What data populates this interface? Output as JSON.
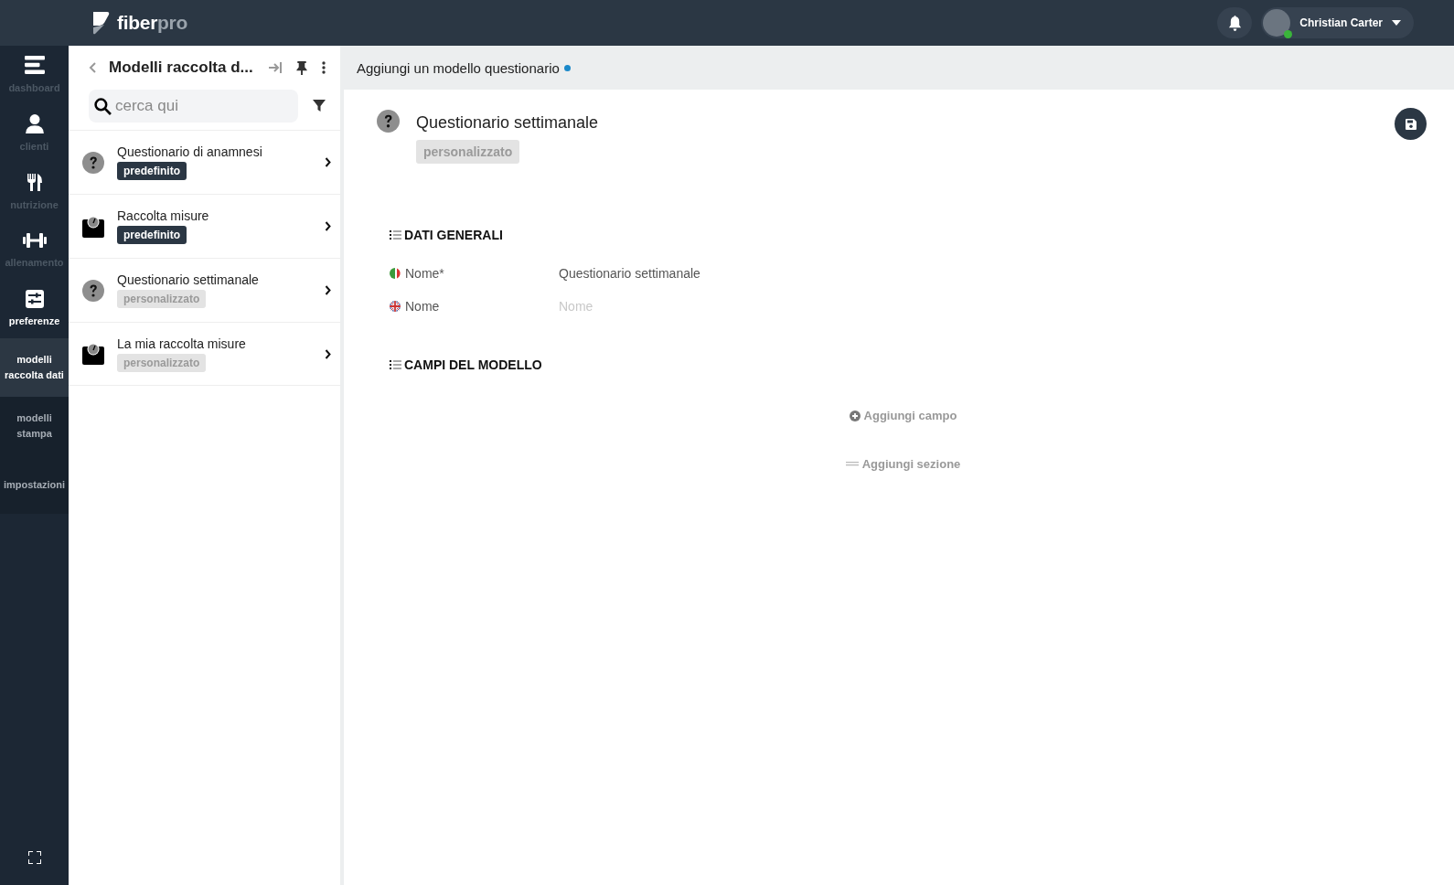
{
  "topbar": {
    "logo": "fiber",
    "logo_accent": "pro",
    "user": {
      "name": "Christian Carter",
      "online": true
    }
  },
  "nav": [
    {
      "label": "dashboard",
      "kind": "bars",
      "dimmed": true,
      "selected": false
    },
    {
      "label": "clienti",
      "kind": "user",
      "dimmed": true,
      "selected": false
    },
    {
      "label": "nutrizione",
      "kind": "cutlery",
      "dimmed": true,
      "selected": false
    },
    {
      "label": "allenamento",
      "kind": "dumbbell",
      "dimmed": true,
      "selected": false
    },
    {
      "label": "preferenze",
      "kind": "sliders",
      "dimmed": false,
      "selected": false
    },
    {
      "label": "modelli raccolta dati",
      "kind": "text",
      "selected": true
    },
    {
      "label": "modelli stampa",
      "kind": "text",
      "selected": false
    },
    {
      "label": "impostazioni",
      "kind": "text",
      "selected": false
    }
  ],
  "list_panel": {
    "title": "Modelli raccolta d...",
    "search": {
      "placeholder": "cerca qui"
    },
    "items": [
      {
        "title": "Questionario di anamnesi",
        "tag": "predefinito",
        "builtin": true,
        "kind": "question"
      },
      {
        "title": "Raccolta misure",
        "tag": "predefinito",
        "builtin": true,
        "kind": "scale"
      },
      {
        "title": "Questionario settimanale",
        "tag": "personalizzato",
        "builtin": false,
        "kind": "question"
      },
      {
        "title": "La mia raccolta misure",
        "tag": "personalizzato",
        "builtin": false,
        "kind": "scale"
      }
    ]
  },
  "main": {
    "header": "Aggiungi un modello questionario",
    "unsaved": true,
    "title": "Questionario settimanale",
    "tag": "personalizzato",
    "builtin": false,
    "kind": "question",
    "sections": [
      {
        "heading": "DATI GENERALI",
        "fields": [
          {
            "kind": "italian",
            "label": "Nome*",
            "value": "Questionario settimanale"
          },
          {
            "kind": "british",
            "label": "Nome",
            "placeholder": "Nome"
          }
        ]
      },
      {
        "heading": "CAMPI DEL MODELLO"
      }
    ],
    "actions": [
      {
        "kind": "field",
        "label": "Aggiungi campo"
      },
      {
        "kind": "section",
        "label": "Aggiungi sezione"
      }
    ]
  }
}
